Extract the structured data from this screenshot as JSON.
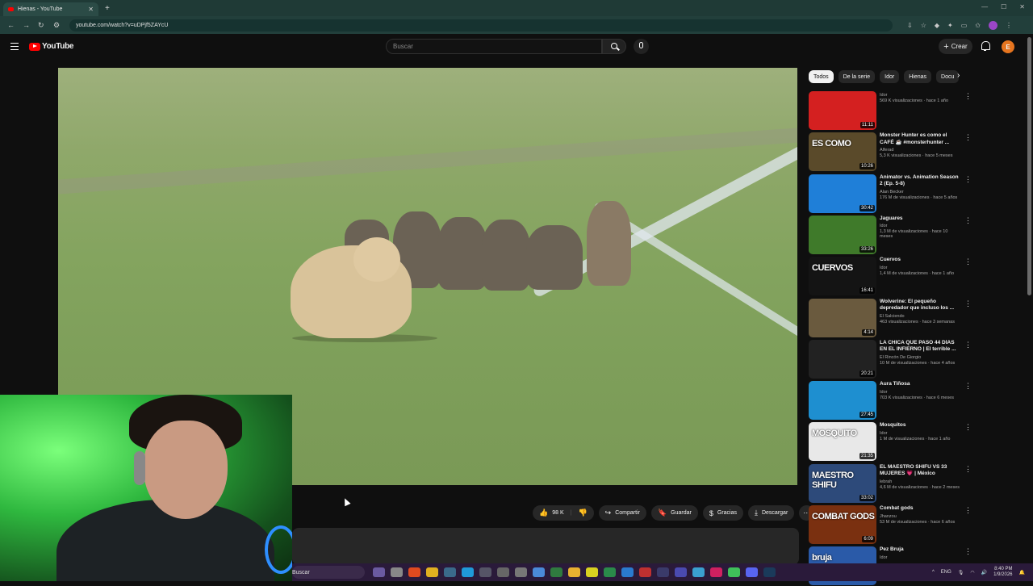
{
  "browser": {
    "tab_title": "Hienas - YouTube",
    "new_tab": "+",
    "url": "youtube.com/watch?v=uDPjf5ZAYcU"
  },
  "header": {
    "logo_text": "YouTube",
    "search_placeholder": "Buscar",
    "create_label": "Crear",
    "avatar_letter": "E"
  },
  "actions": {
    "likes": "98 K",
    "share": "Compartir",
    "save": "Guardar",
    "thanks": "Gracias",
    "download": "Descargar"
  },
  "sidebar": {
    "chips": [
      "Todos",
      "De la serie",
      "Idor",
      "Hienas",
      "Docu"
    ],
    "active_chip": "Todos",
    "recommendations": [
      {
        "title": "",
        "channel": "Idor",
        "stats": "569 K visualizaciones · hace 1 año",
        "duration": "11:11",
        "thumb_text": "",
        "thumb_color": "#d42020"
      },
      {
        "title": "Monster Hunter es como el CAFÉ ☕ #monsterhunter ...",
        "channel": "Alferad",
        "stats": "5,3 K visualizaciones · hace 5 meses",
        "duration": "10:26",
        "thumb_text": "ES COMO",
        "thumb_color": "#5a4a2a"
      },
      {
        "title": "Animator vs. Animation Season 2 (Ep. 5-8)",
        "channel": "Alan Becker",
        "stats": "176 M de visualizaciones · hace 5 años",
        "duration": "30:42",
        "thumb_text": "",
        "thumb_color": "#1f7fd8"
      },
      {
        "title": "Jaguares",
        "channel": "Idor",
        "stats": "1,3 M de visualizaciones · hace 10 meses",
        "duration": "33:26",
        "thumb_text": "",
        "thumb_color": "#3f7a2a"
      },
      {
        "title": "Cuervos",
        "channel": "Idor",
        "stats": "1,4 M de visualizaciones · hace 1 año",
        "duration": "16:41",
        "thumb_text": "CUERVOS",
        "thumb_color": "#141414"
      },
      {
        "title": "Wolverine: El pequeño depredador que incluso los ...",
        "channel": "El Salciendo",
        "stats": "463 visualizaciones · hace 3 semanas",
        "duration": "4:14",
        "thumb_text": "",
        "thumb_color": "#6a5a3e"
      },
      {
        "title": "LA CHICA QUE PASÓ 44 DÍAS EN EL INFIERNO | El terrible ...",
        "channel": "El Rincón De Giorgio",
        "stats": "10 M de visualizaciones · hace 4 años",
        "duration": "20:21",
        "thumb_text": "",
        "thumb_color": "#222222"
      },
      {
        "title": "Aura Tiñosa",
        "channel": "Idor",
        "stats": "703 K visualizaciones · hace 6 meses",
        "duration": "27:45",
        "thumb_text": "",
        "thumb_color": "#1e8fd0"
      },
      {
        "title": "Mosquitos",
        "channel": "Idor",
        "stats": "1 M de visualizaciones · hace 1 año",
        "duration": "21:35",
        "thumb_text": "MOSQUITO",
        "thumb_color": "#e8e8e8"
      },
      {
        "title": "EL MAESTRO SHIFU VS 33 MUJERES 💗 | México",
        "channel": "lebrah",
        "stats": "4,6 M de visualizaciones · hace 2 meses",
        "duration": "33:02",
        "thumb_text": "MAESTRO SHIFU",
        "thumb_color": "#2d4a7a"
      },
      {
        "title": "Combat gods",
        "channel": "Jhanzou",
        "stats": "53 M de visualizaciones · hace 6 años",
        "duration": "6:09",
        "thumb_text": "COMBAT GODS",
        "thumb_color": "#7a3010"
      },
      {
        "title": "Pez Bruja",
        "channel": "Idor",
        "stats": "",
        "duration": "",
        "thumb_text": "bruja",
        "thumb_color": "#2a5aa8"
      }
    ]
  },
  "taskbar": {
    "search": "Buscar",
    "lang": "ENG",
    "time": "8:40 PM",
    "date": "1/9/2026"
  }
}
